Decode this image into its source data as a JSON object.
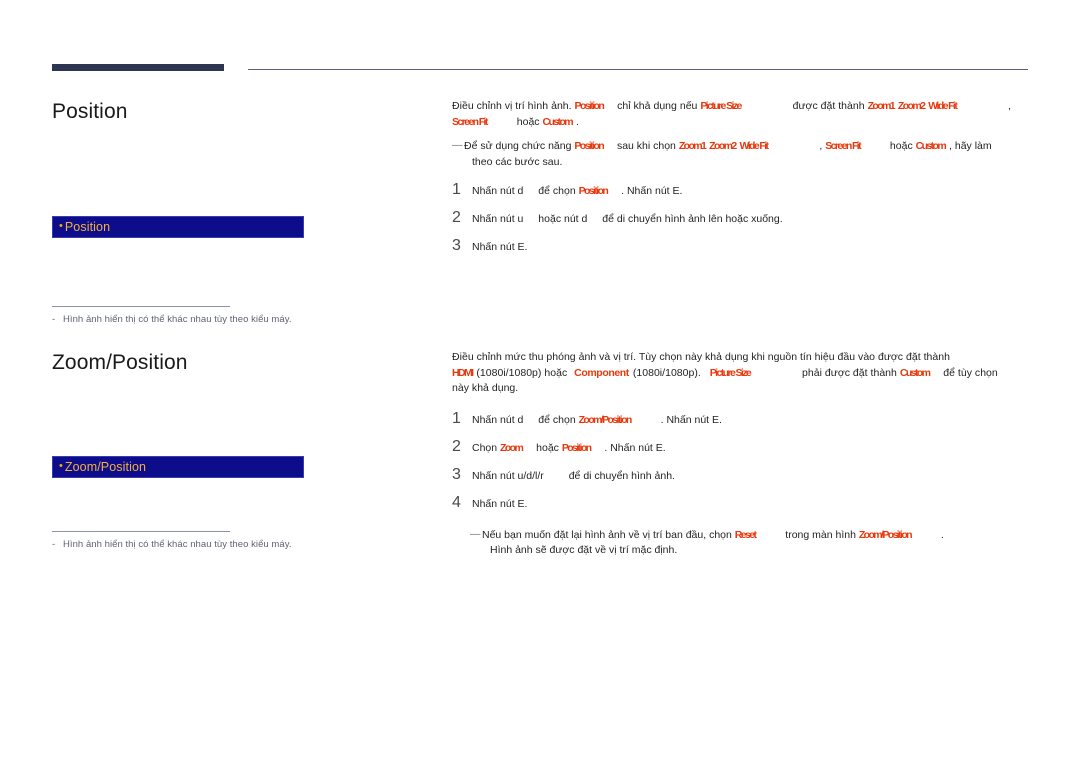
{
  "page": {
    "language": "vi",
    "accent_navy": "#2e3553",
    "menu_box_bg": "#0d0d8c",
    "menu_box_text": "#f2b13a",
    "keyword_color": "#e8380d",
    "note_color": "#5f6473"
  },
  "sections": [
    {
      "id": "position",
      "title": "Position",
      "menu_box": {
        "bullet": "bullet-dot-icon",
        "label": "Position"
      },
      "note": {
        "dash": "-",
        "text": "Hình ảnh hiển thị có thể khác nhau tùy theo kiểu máy."
      },
      "intro": {
        "p1_a": "Điều chỉnh vị trí hình ảnh.",
        "kw_position": "Position",
        "p1_b": "chỉ khả dụng nếu",
        "kw_picture_size": "Picture Size",
        "p1_c": "được đặt thành",
        "kw_zoom1": "Zoom1",
        "kw_zoom2": "Zoom2",
        "kw_wide_fit": "Wide Fit",
        "p1_comma": ",",
        "kw_screen_fit": "Screen Fit",
        "p1_d": "hoặc",
        "kw_custom": "Custom",
        "p1_e": "."
      },
      "tip": {
        "mark": "—",
        "t_a": "Để sử dụng chức năng",
        "kw_position": "Position",
        "t_b": "sau khi chọn",
        "kw_zoom1": "Zoom1",
        "kw_zoom2": "Zoom2",
        "kw_wide_fit": "Wide Fit",
        "t_comma": ",",
        "kw_screen_fit": "Screen Fit",
        "t_c": "hoặc",
        "kw_custom": "Custom",
        "t_d": ", hãy làm",
        "t_e": "theo các bước sau."
      },
      "steps": [
        {
          "num": "1",
          "a": "Nhấn nút d",
          "b": "để chọn",
          "kw": "Position",
          "c": ". Nhấn nút E."
        },
        {
          "num": "2",
          "a": "Nhấn nút u",
          "b": "hoặc nút d",
          "c": "để di chuyển hình ảnh lên hoặc xuống."
        },
        {
          "num": "3",
          "a": "Nhấn nút E."
        }
      ]
    },
    {
      "id": "zoom-position",
      "title": "Zoom/Position",
      "menu_box": {
        "bullet": "bullet-dot-icon",
        "label": "Zoom/Position"
      },
      "note": {
        "dash": "-",
        "text": "Hình ảnh hiển thị có thể khác nhau tùy theo kiểu máy."
      },
      "intro": {
        "p1_a": "Điều chỉnh mức thu phóng ảnh và vị trí. Tùy chọn này khả dụng khi nguồn tín hiệu đầu vào được đặt thành",
        "kw_hdmi": "HDMI",
        "p1_b": "(1080i/1080p) hoặc",
        "kw_component": "Component",
        "p1_c": "(1080i/1080p).",
        "kw_picture_size": "Picture Size",
        "p1_d": "phải được đặt thành",
        "kw_custom": "Custom",
        "p1_e": "để tùy chọn",
        "p1_f": "này khả dụng."
      },
      "steps": [
        {
          "num": "1",
          "a": "Nhấn nút d",
          "b": "để chọn",
          "kw": "Zoom/Position",
          "c": ". Nhấn nút E."
        },
        {
          "num": "2",
          "a": "Chọn",
          "kw1": "Zoom",
          "b": "hoặc",
          "kw2": "Position",
          "c": ". Nhấn nút E."
        },
        {
          "num": "3",
          "a": "Nhấn nút u/d/l/r",
          "b": "để di chuyển hình ảnh."
        },
        {
          "num": "4",
          "a": "Nhấn nút E."
        }
      ],
      "tip": {
        "mark": "—",
        "t_a": "Nếu bạn muốn đặt lại hình ảnh về vị trí ban đầu, chọn",
        "kw_reset": "Reset",
        "t_b": "trong màn hình",
        "kw_zoom_position": "Zoom/Position",
        "t_c": ".",
        "t_d": "Hình ảnh sẽ được đặt về vị trí mặc định."
      }
    }
  ]
}
